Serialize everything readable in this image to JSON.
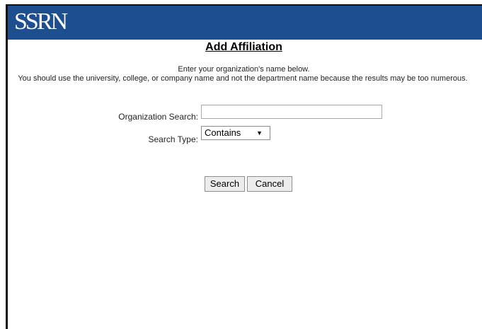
{
  "header": {
    "logo_text": "SSRN",
    "color": "#1d4e8f"
  },
  "page": {
    "title": "Add Affiliation",
    "instruction_line1": "Enter your organization's name below.",
    "instruction_line2": "You should use the university, college, or company name and not the department name because the results may be too numerous."
  },
  "form": {
    "org_search_label": "Organization Search:",
    "org_search_value": "",
    "search_type_label": "Search Type:",
    "search_type_selected": "Contains",
    "search_button": "Search",
    "cancel_button": "Cancel"
  }
}
